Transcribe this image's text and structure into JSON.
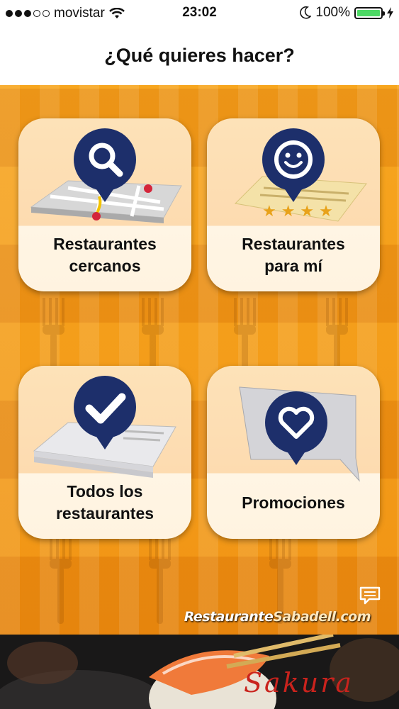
{
  "status_bar": {
    "carrier": "movistar",
    "time": "23:02",
    "battery": "100%",
    "signal_bars_filled": 3,
    "signal_bars_total": 5
  },
  "header": {
    "title": "¿Qué quieres hacer?"
  },
  "tiles": [
    {
      "label": "Restaurantes\ncercanos",
      "icon": "search-icon"
    },
    {
      "label": "Restaurantes\npara mí",
      "icon": "smiley-icon"
    },
    {
      "label": "Todos los\nrestaurantes",
      "icon": "checkmark-icon"
    },
    {
      "label": "Promociones",
      "icon": "heart-icon"
    }
  ],
  "brand": {
    "part1": "Restaurante",
    "part2": "Sabadell.com"
  },
  "banner": {
    "text": "Sakura"
  },
  "colors": {
    "accent_orange": "#f39a18",
    "icon_blue": "#1d2f6b",
    "battery_green": "#4cd964",
    "banner_red": "#c9231d"
  }
}
